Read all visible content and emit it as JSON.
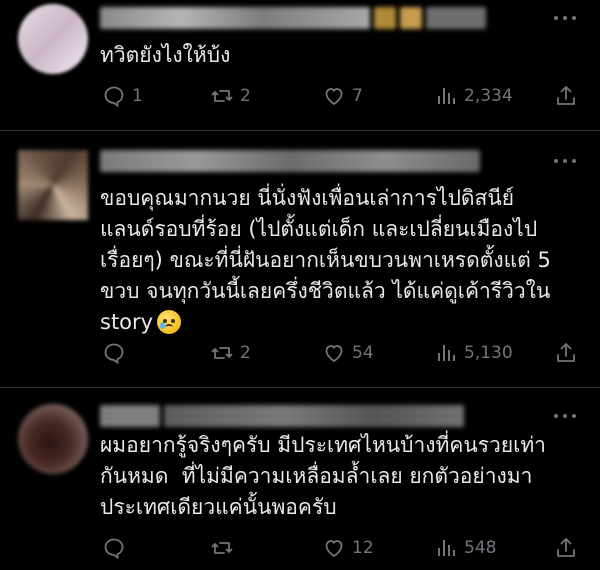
{
  "tweets": [
    {
      "text": "ทวิตยังไงให้บ้ง",
      "replies": "1",
      "retweets": "2",
      "likes": "7",
      "views": "2,334"
    },
    {
      "text": "ขอบคุณมากนวย นี่นั่งฟังเพื่อนเล่าการไปดิสนีย์\nแลนด์รอบที่ร้อย (ไปตั้งแต่เด็ก และเปลี่ยนเมืองไป\nเรื่อยๆ) ขณะที่นี่ฝันอยากเห็นขบวนพาเหรดตั้งแต่ 5\nขวบ จนทุกวันนี้เลยครึ่งชีวิตแล้ว ได้แค่ดูเค้ารีวิวใน\nstory",
      "emoji": "crying-face-emoji",
      "replies": "",
      "retweets": "2",
      "likes": "54",
      "views": "5,130"
    },
    {
      "text": "ผมอยากรู้จริงๆครับ มีประเทศไหนบ้างที่คนรวยเท่า\nกันหมด  ที่ไม่มีความเหลื่อมล้ำเลย ยกตัวอย่างมา\nประเทศเดียวแค่นั้นพอครับ",
      "replies": "",
      "retweets": "",
      "likes": "12",
      "views": "548"
    }
  ],
  "icons": {
    "reply": "reply-icon",
    "retweet": "retweet-icon",
    "like": "heart-icon",
    "views": "views-icon",
    "share": "share-icon",
    "more": "more-icon"
  },
  "colors": {
    "background": "#000000",
    "text": "#e7e9ea",
    "muted": "#71767b",
    "divider": "#2f3336"
  }
}
